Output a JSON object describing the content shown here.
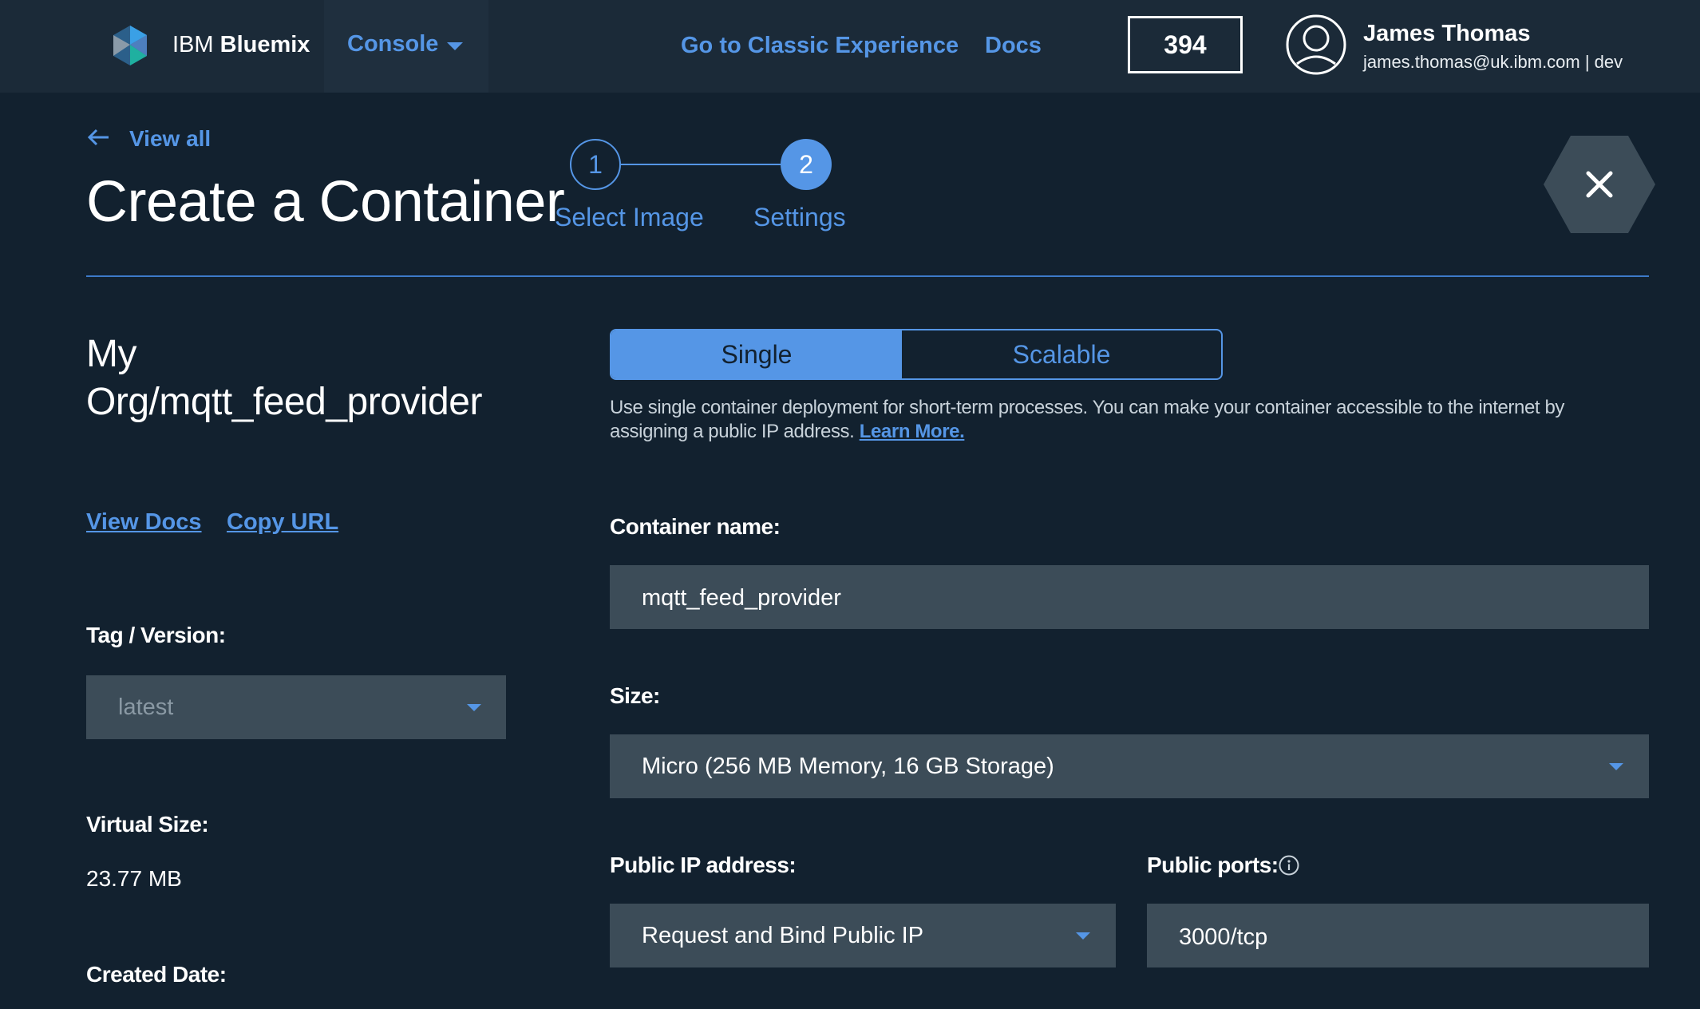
{
  "nav": {
    "brand_light": "IBM",
    "brand_bold": "Bluemix",
    "console": "Console",
    "classic": "Go to Classic Experience",
    "docs": "Docs",
    "counter": "394",
    "user_name": "James Thomas",
    "user_sub": "james.thomas@uk.ibm.com | dev"
  },
  "header": {
    "back": "View all",
    "title": "Create a Container",
    "steps": [
      {
        "number": "1",
        "label": "Select Image"
      },
      {
        "number": "2",
        "label": "Settings"
      }
    ]
  },
  "left": {
    "image_name": "My Org/mqtt_feed_provider",
    "view_docs": "View Docs",
    "copy_url": "Copy URL",
    "tag_label": "Tag / Version:",
    "tag_value": "latest",
    "virtual_size_label": "Virtual Size:",
    "virtual_size_value": "23.77 MB",
    "created_label": "Created Date:"
  },
  "right": {
    "toggle_single": "Single",
    "toggle_scalable": "Scalable",
    "description": "Use single container deployment for short-term processes. You can make your container accessible to the internet by assigning a public IP address.",
    "learn_more": "Learn More.",
    "container_name_label": "Container name:",
    "container_name_value": "mqtt_feed_provider",
    "size_label": "Size:",
    "size_value": "Micro (256 MB Memory, 16 GB Storage)",
    "public_ip_label": "Public IP address:",
    "public_ip_value": "Request and Bind Public IP",
    "public_ports_label": "Public ports:",
    "public_ports_value": "3000/tcp"
  },
  "colors": {
    "background": "#12212f",
    "nav_background": "#1b2a38",
    "accent": "#5596e6",
    "field_background": "#3c4c58"
  },
  "icons": [
    "bluemix-logo-icon",
    "chevron-down-icon",
    "avatar-icon",
    "arrow-left-icon",
    "close-icon",
    "info-icon"
  ]
}
